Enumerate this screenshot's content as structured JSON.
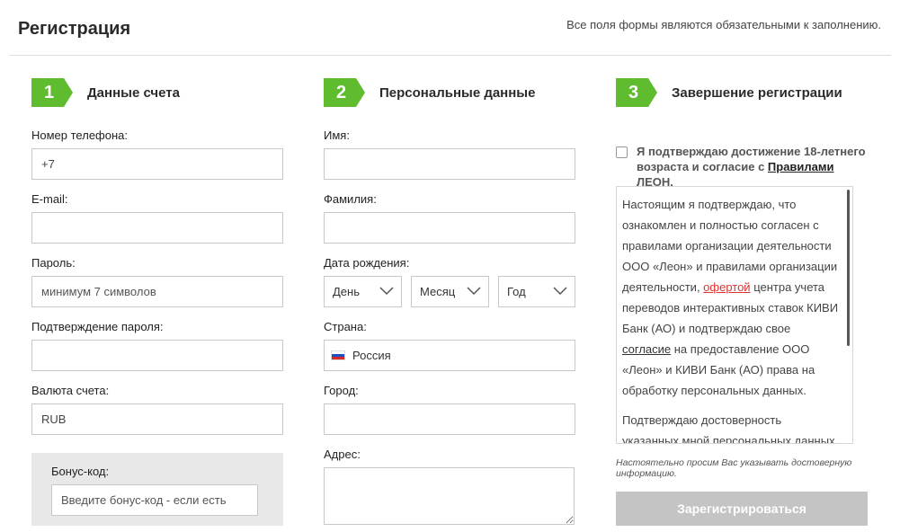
{
  "header": {
    "title": "Регистрация",
    "required_note": "Все поля формы являются обязательными к заполнению."
  },
  "steps": [
    {
      "number": "1",
      "title": "Данные счета"
    },
    {
      "number": "2",
      "title": "Персональные данные"
    },
    {
      "number": "3",
      "title": "Завершение регистрации"
    }
  ],
  "account": {
    "phone_label": "Номер телефона:",
    "phone_value": "+7",
    "email_label": "E-mail:",
    "password_label": "Пароль:",
    "password_placeholder": "минимум 7 символов",
    "password_confirm_label": "Подтверждение пароля:",
    "currency_label": "Валюта счета:",
    "currency_value": "RUB",
    "bonus_label": "Бонус-код:",
    "bonus_placeholder": "Введите бонус-код - если есть"
  },
  "personal": {
    "first_name_label": "Имя:",
    "last_name_label": "Фамилия:",
    "birth_label": "Дата рождения:",
    "day": "День",
    "month": "Месяц",
    "year": "Год",
    "country_label": "Страна:",
    "country_value": "Россия",
    "city_label": "Город:",
    "address_label": "Адрес:"
  },
  "finish": {
    "checkbox_text_prefix": "Я подтверждаю достижение 18-летнего возраста и согласие с ",
    "checkbox_link": "Правилами",
    "checkbox_text_suffix": " ЛЕОН.",
    "terms_p1_a": "Настоящим я подтверждаю, что ознакомлен и полностью согласен с правилами организации деятельности ООО «Леон» и правилами организации деятельности, ",
    "terms_p1_offer": "офертой",
    "terms_p1_b": " центра учета переводов интерактивных ставок КИВИ Банк (АО) и подтверждаю свое ",
    "terms_p1_consent": "согласие",
    "terms_p1_c": " на предоставление ООО «Леон» и КИВИ Банк (АО) права на обработку персональных данных.",
    "terms_p2": "Подтверждаю достоверность указанных мной персональных данных",
    "notice": "Настоятельно просим Вас указывать достоверную информацию.",
    "submit_label": "Зарегистрироваться"
  },
  "colors": {
    "accent": "#5fbc2e",
    "submit_disabled": "#c4c4c4",
    "link_red": "#dd3333"
  }
}
